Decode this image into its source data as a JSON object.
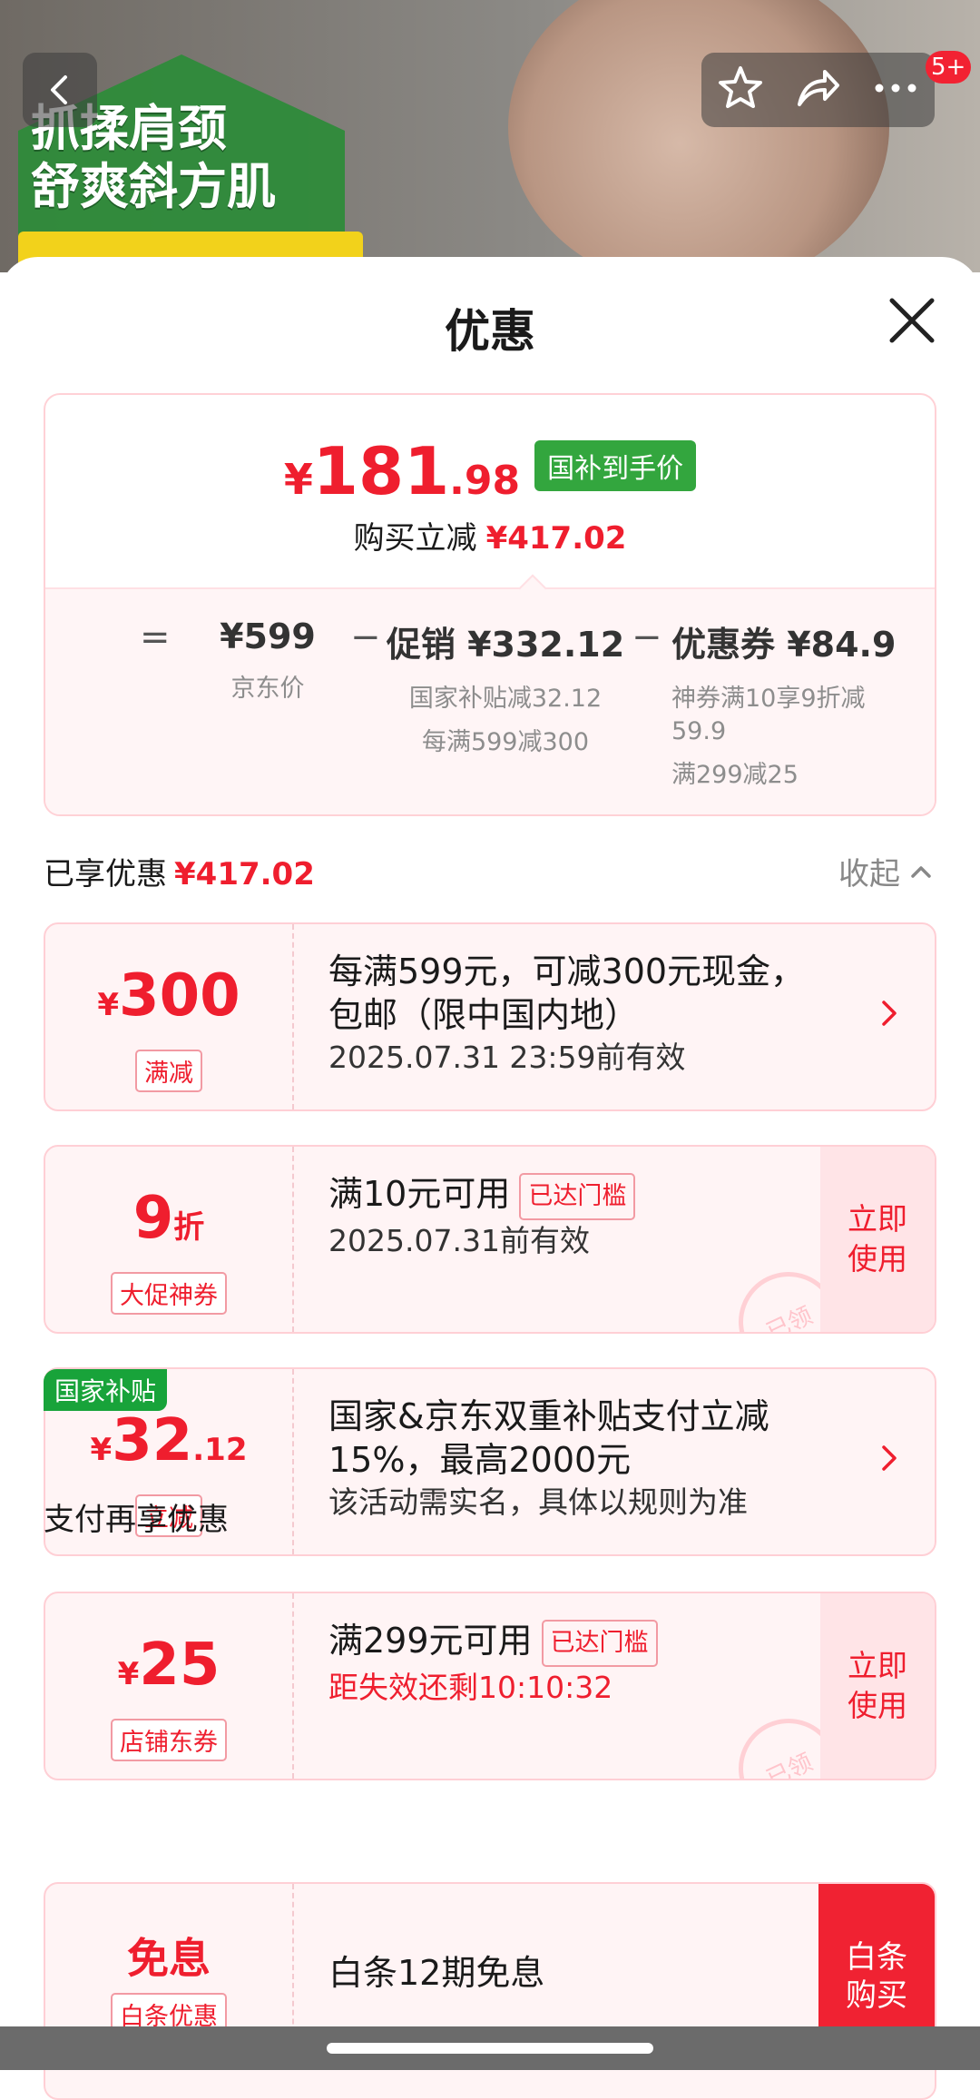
{
  "hero": {
    "slogan_line1": "抓揉肩颈",
    "slogan_line2": "舒爽斜方肌"
  },
  "top_actions": {
    "badge": "5+"
  },
  "sheet": {
    "title": "优惠"
  },
  "price_summary": {
    "currency": "¥",
    "price_int": "181",
    "price_dec": ".98",
    "tag": "国补到手价",
    "save_label": "购买立减",
    "save_amount": "¥417.02"
  },
  "breakdown": {
    "eq": "=",
    "minus": "−",
    "jd_price": "¥599",
    "jd_label": "京东价",
    "promo": "促销 ¥332.12",
    "promo_sub1": "国家补贴减32.12",
    "promo_sub2": "每满599减300",
    "coupon": "优惠券 ¥84.9",
    "coupon_sub1": "神券满10享9折减59.9",
    "coupon_sub2": "满299减25"
  },
  "enjoyed": {
    "label": "已享优惠",
    "amount": "¥417.02",
    "collapse": "收起"
  },
  "coupons": [
    {
      "small": "¥",
      "big": "300",
      "tag": "满减",
      "line1": "每满599元，可减300元现金，包邮（限中国内地）",
      "line2": "2025.07.31 23:59前有效"
    },
    {
      "big": "9",
      "small": "折",
      "tag": "大促神券",
      "line1": "满10元可用",
      "threshold": "已达门槛",
      "line2": "2025.07.31前有效",
      "action": "立即使用",
      "stamp": "已领"
    },
    {
      "gov_tag": "国家补贴",
      "small": "¥",
      "big": "32",
      "dec": ".12",
      "tag": "立减",
      "line1": "国家&京东双重补贴支付立减15%，最高2000元",
      "line2": "该活动需实名，具体以规则为准"
    },
    {
      "small": "¥",
      "big": "25",
      "tag": "店铺东券",
      "line1": "满299元可用",
      "threshold": "已达门槛",
      "line2": "距失效还剩10:10:32",
      "action": "立即使用",
      "stamp": "已领"
    }
  ],
  "pay_section": {
    "title": "支付再享优惠",
    "amount": "免息",
    "tag": "白条优惠",
    "line1": "白条12期免息",
    "action": "白条购买"
  },
  "colors": {
    "accent_red": "#ef1e2e",
    "gov_green": "#33a63e",
    "coupon_bg": "#fff4f5"
  }
}
